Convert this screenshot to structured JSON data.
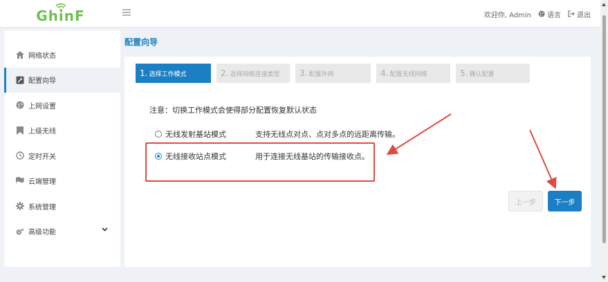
{
  "header": {
    "logo_text": "GhinF",
    "welcome": "欢迎你, Admin",
    "language": "语言",
    "logout": "退出"
  },
  "sidebar": {
    "items": [
      {
        "label": "网络状态",
        "icon": "home-icon"
      },
      {
        "label": "配置向导",
        "icon": "wizard-icon"
      },
      {
        "label": "上网设置",
        "icon": "globe-icon"
      },
      {
        "label": "上级无线",
        "icon": "bookmark-icon"
      },
      {
        "label": "定时开关",
        "icon": "clock-icon"
      },
      {
        "label": "云端管理",
        "icon": "flag-icon"
      },
      {
        "label": "系统管理",
        "icon": "gear-icon"
      },
      {
        "label": "高级功能",
        "icon": "gears-icon"
      }
    ],
    "active_index": 1
  },
  "main": {
    "title": "配置向导",
    "steps": [
      {
        "num": "1.",
        "label": "选择工作模式"
      },
      {
        "num": "2.",
        "label": "选择网络连接类型"
      },
      {
        "num": "3.",
        "label": "配置外网"
      },
      {
        "num": "4.",
        "label": "配置无线网络"
      },
      {
        "num": "5.",
        "label": "确认配置"
      }
    ],
    "active_step": 0,
    "note": "注意：切换工作模式会使得部分配置恢复默认状态",
    "options": [
      {
        "label": "无线发射基站模式",
        "desc": "支持无线点对点、点对多点的远距离传输。",
        "checked": false
      },
      {
        "label": "无线接收站点模式",
        "desc": "用于连接无线基站的传输接收点。",
        "checked": true
      }
    ],
    "prev_button": "上一步",
    "next_button": "下一步"
  },
  "colors": {
    "accent": "#1c7fc3",
    "logo_green": "#6ec04e",
    "annotation_red": "#e04a3f"
  }
}
